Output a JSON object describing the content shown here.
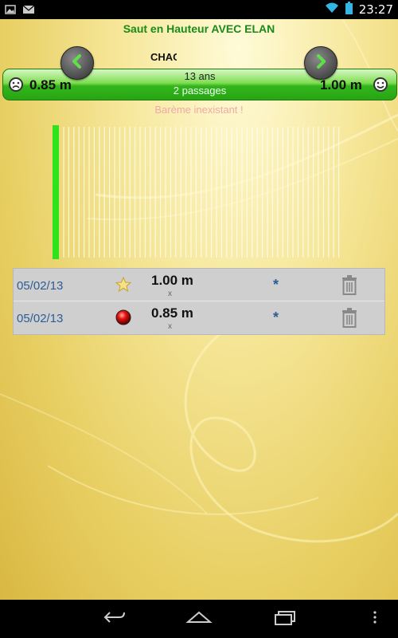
{
  "status_bar": {
    "time": "23:27"
  },
  "header": {
    "title": "Saut en Hauteur AVEC ELAN",
    "athlete_name": "CHAC"
  },
  "navigation": {
    "prev_icon": "chevron-left-icon",
    "next_icon": "chevron-right-icon"
  },
  "summary": {
    "start_height": "0.85 m",
    "best_height": "1.00 m",
    "age": "13 ans",
    "passages": "2 passages",
    "bareme": "Barème inexistant !"
  },
  "results": [
    {
      "date": "05/02/13",
      "icon": "star-icon",
      "height": "1.00 m",
      "mark": "x",
      "asterisk": "*"
    },
    {
      "date": "05/02/13",
      "icon": "red-ball-icon",
      "height": "0.85 m",
      "mark": "x",
      "asterisk": "*"
    }
  ],
  "colors": {
    "title_green": "#1a8a1a",
    "bar_green": "#33b51c",
    "date_blue": "#2c5d94",
    "graph_line": "#2ee21c"
  }
}
